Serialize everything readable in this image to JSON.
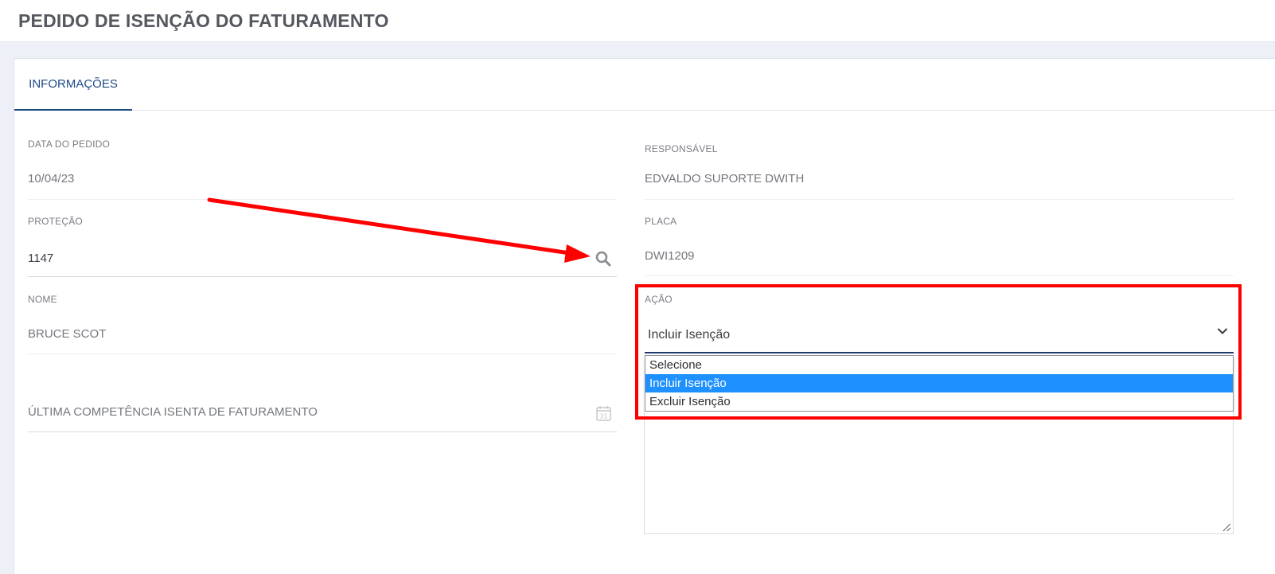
{
  "page": {
    "title": "PEDIDO DE ISENÇÃO DO FATURAMENTO"
  },
  "tabs": [
    {
      "label": "INFORMAÇÕES",
      "active": true
    }
  ],
  "form": {
    "data_pedido": {
      "label": "DATA DO PEDIDO",
      "value": "10/04/23"
    },
    "responsavel": {
      "label": "RESPONSÁVEL",
      "value": "EDVALDO SUPORTE DWITH"
    },
    "protecao": {
      "label": "PROTEÇÃO",
      "value": "1147"
    },
    "placa": {
      "label": "PLACA",
      "value": "DWI1209"
    },
    "nome": {
      "label": "NOME",
      "value": "BRUCE SCOT"
    },
    "acao": {
      "label": "AÇÃO",
      "value": "Incluir Isenção",
      "options": [
        "Selecione",
        "Incluir Isenção",
        "Excluir Isenção"
      ],
      "selected_index": 1
    },
    "ultima_competencia": {
      "placeholder": "ÚLTIMA COMPETÊNCIA ISENTA DE FATURAMENTO"
    }
  },
  "icons": {
    "search": "search-icon",
    "calendar": "calendar-icon",
    "chevron": "chevron-down-icon",
    "calendar_day": "31"
  },
  "colors": {
    "accent": "#1e4a86",
    "selected_option": "#1e90ff",
    "annotation": "#ff0000"
  }
}
